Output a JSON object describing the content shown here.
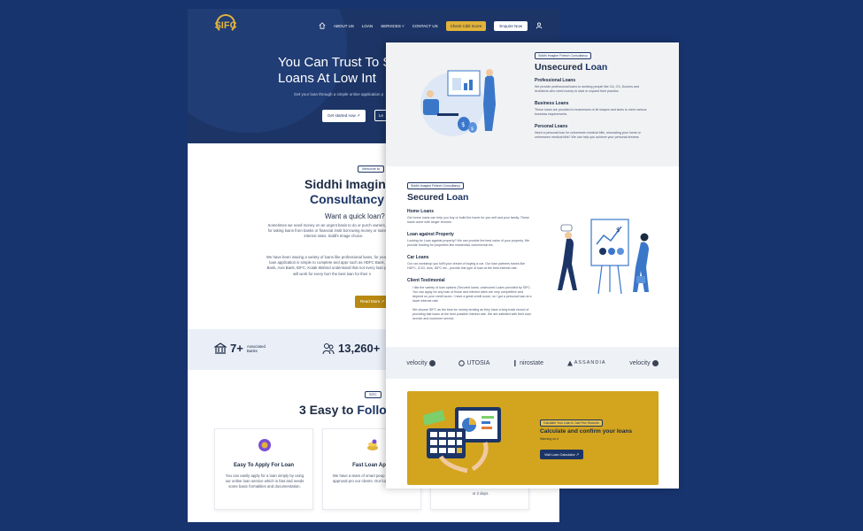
{
  "colors": {
    "background": "#18346e",
    "navy": "#1c3566",
    "gold": "#e2b33a",
    "read_more": "#b88a12",
    "calculator_bg": "#d3a41d"
  },
  "left_page": {
    "logo": "SIFC",
    "nav": {
      "items": [
        "ABOUT US",
        "LOAN",
        "SERVICES ˅",
        "CONTACT US"
      ],
      "check_cibil": "Check Cibil Score",
      "enquire": "Enquire Now"
    },
    "hero": {
      "title": "You Can Trust To S\nLoans At Low Int",
      "subtitle": "Get your loan through a simple online application p",
      "get_started": "Get started now ↗",
      "learn": "Le"
    },
    "about": {
      "badge": "Welcome to",
      "title_line1": "Siddhi Imagin",
      "title_line2": "Consultancy",
      "question": "Want a quick loan? C",
      "p1": "Sometimes we need money on an urgent basis to do or purch owners, etc.) go for taking loans from banks or financial instit borrowing money or loans at best interest rates. Siddhi Image choice.",
      "p2": "We have been issuing a variety of loans like professional loans, for years. Our loan application is simple to complete and appr such as HDFC Bank, ICICI Bank, Axis Bank, IDFC, Kotak Mahind understand that not every loan product will work for every borr the best loan for their s",
      "read_more": "Read More ↗"
    },
    "stats": [
      {
        "num": "7+",
        "label": "Associated Banks",
        "icon": "bank-icon"
      },
      {
        "num": "13,260+",
        "label": "",
        "icon": "users-icon"
      }
    ],
    "steps": {
      "badge": "SIFC",
      "title_a": "3 Easy to ",
      "title_b": "Follo",
      "cards": [
        {
          "title": "Easy To Apply For Loan",
          "text": "You can easily apply for a loan simply by using our online loan service which is fast and needs some basic formalities and documentation.",
          "icon": "apply-icon"
        },
        {
          "title": "Fast Loan Appr",
          "text": "We have a team of smart peop making the loan approval pro our clients. Our loan experts away",
          "icon": "coins-icon"
        },
        {
          "title": "",
          "text": "or 2 days.",
          "icon": ""
        }
      ]
    }
  },
  "right_page": {
    "unsecured": {
      "tag": "Siddhi Imagine Fintech Consultancy",
      "title_a": "Unsecured ",
      "title_b": "Loan",
      "items": [
        {
          "h": "Professional Loans",
          "p": "We provide professional loans to working people like CA, CS, Doctors and Architects who need money to start or expand their practice."
        },
        {
          "h": "Business Loans",
          "p": "These loans are provided to businesses of all shapes and sizes to meet various business requirements."
        },
        {
          "h": "Personal Loans",
          "p": "Need a personal loan for unforeseen medical bills, renovating your home or unforeseen medical bills? We can help you achieve your personal dreams."
        }
      ]
    },
    "secured": {
      "tag": "Siddhi Imagine Fintech Consultancy",
      "title_a": "Secured ",
      "title_b": "Loan",
      "items": [
        {
          "h": "Home Loans",
          "p": "Get home loans can help you buy or build the home for you self and your family. These loans come with longer tenures."
        },
        {
          "h": "Loan against Property",
          "p": "Looking for Loan against property? We can provide the best value of your property. We provide funding for properties like residential, commercial etc."
        },
        {
          "h": "Car Loans",
          "p": "Our car workshop you fulfil your dream of buying a car. Our loan partners banks like HDFC, ICICI, Axis, IDFC etc., provide this type of loan at the best interest rate."
        }
      ],
      "testimonial": {
        "h": "Client Testimonial",
        "bullets": [
          "I like the variety of loan options (Secured loans, unsecured Loans provided by SIFC. You can apply for any loan of those and interest rates are very competitive and depend on your credit score. I have a great credit score, so I got a personal loan at a lower interest rate.",
          "We choose SIFC as the best for money lending as they have a long track record of providing fast loans at the best possible interest rate. We are satisfied with their loan service and customer service."
        ]
      }
    },
    "brands": [
      "velocity",
      "UTOSIA",
      "nirostate",
      "ASSANDIA",
      "velocity"
    ],
    "calculator": {
      "tag": "Calculate Your Loan In Just Few Seconds",
      "title": "Calculate and confirm your loans",
      "sub": "Warning on it",
      "button": "Visit Loan Calculator ↗"
    }
  }
}
